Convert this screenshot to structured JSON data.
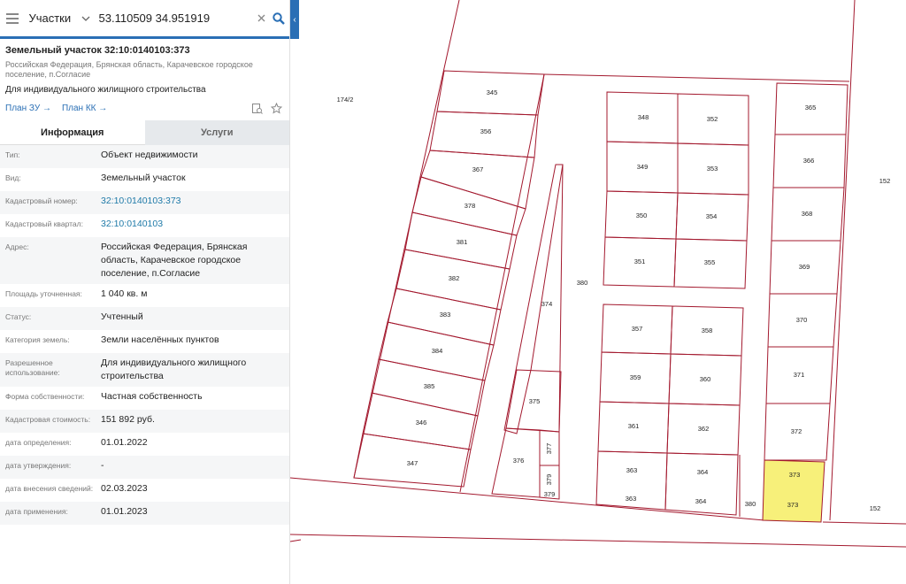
{
  "search": {
    "layer": "Участки",
    "query": "53.110509 34.951919"
  },
  "parcel": {
    "title": "Земельный участок 32:10:0140103:373",
    "address": "Российская Федерация, Брянская область, Карачевское городское поселение, п.Согласие",
    "purpose": "Для индивидуального жилищного строительства"
  },
  "links": {
    "plan_zu": "План ЗУ →",
    "plan_kk": "План КК →"
  },
  "tabs": {
    "info": "Информация",
    "services": "Услуги"
  },
  "fields": [
    {
      "label": "Тип:",
      "value": "Объект недвижимости",
      "link": false
    },
    {
      "label": "Вид:",
      "value": "Земельный участок",
      "link": false
    },
    {
      "label": "Кадастровый номер:",
      "value": "32:10:0140103:373",
      "link": true
    },
    {
      "label": "Кадастровый квартал:",
      "value": "32:10:0140103",
      "link": true
    },
    {
      "label": "Адрес:",
      "value": "Российская Федерация, Брянская область, Карачевское городское поселение, п.Согласие",
      "link": false
    },
    {
      "label": "Площадь уточненная:",
      "value": "1 040 кв. м",
      "link": false
    },
    {
      "label": "Статус:",
      "value": "Учтенный",
      "link": false
    },
    {
      "label": "Категория земель:",
      "value": "Земли населённых пунктов",
      "link": false
    },
    {
      "label": "Разрешенное использование:",
      "value": "Для индивидуального жилищного строительства",
      "link": false
    },
    {
      "label": "Форма собственности:",
      "value": "Частная собственность",
      "link": false
    },
    {
      "label": "Кадастровая стоимость:",
      "value": "151 892 руб.",
      "link": false
    },
    {
      "label": "дата определения:",
      "value": "01.01.2022",
      "link": false
    },
    {
      "label": "дата утверждения:",
      "value": "-",
      "link": false
    },
    {
      "label": "дата внесения сведений:",
      "value": "02.03.2023",
      "link": false
    },
    {
      "label": "дата применения:",
      "value": "01.01.2023",
      "link": false
    }
  ],
  "map": {
    "colors": {
      "boundary": "#a3192e",
      "selected": "#f7f07a",
      "accent": "#2a6fb5"
    },
    "labels": {
      "l174": "174/2",
      "l345": "345",
      "l356": "356",
      "l367": "367",
      "l378": "378",
      "l381": "381",
      "l382": "382",
      "l383": "383",
      "l384": "384",
      "l385": "385",
      "l346": "346",
      "l347": "347",
      "l374": "374",
      "l375": "375",
      "l376": "376",
      "l377": "377",
      "l379a": "379",
      "l379b": "379",
      "l380a": "380",
      "l380b": "380",
      "l348": "348",
      "l352": "352",
      "l349": "349",
      "l353": "353",
      "l350": "350",
      "l354": "354",
      "l351": "351",
      "l355": "355",
      "l357": "357",
      "l358": "358",
      "l359": "359",
      "l360": "360",
      "l361": "361",
      "l362": "362",
      "l363a": "363",
      "l364a": "364",
      "l363b": "363",
      "l364b": "364",
      "l365": "365",
      "l366": "366",
      "l368": "368",
      "l369": "369",
      "l370": "370",
      "l371": "371",
      "l372": "372",
      "l373a": "373",
      "l373b": "373",
      "l152a": "152",
      "l152b": "152"
    }
  }
}
